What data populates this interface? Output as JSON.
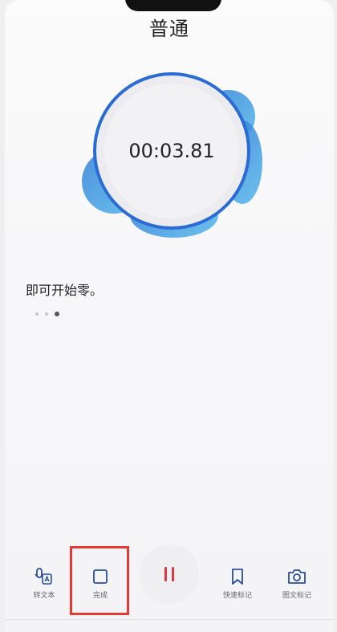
{
  "header": {
    "title": "普通"
  },
  "recorder": {
    "elapsed": "00:03.81"
  },
  "hint": {
    "text": "即可开始零。"
  },
  "pager": {
    "total": 3,
    "active_index": 2
  },
  "toolbar": {
    "to_text_label": "转文本",
    "done_label": "完成",
    "quick_mark_label": "快速标记",
    "photo_mark_label": "图文标记"
  },
  "colors": {
    "accent_blue": "#2a6bd4",
    "pause_red": "#d93a4a",
    "highlight_red": "#e53935"
  }
}
